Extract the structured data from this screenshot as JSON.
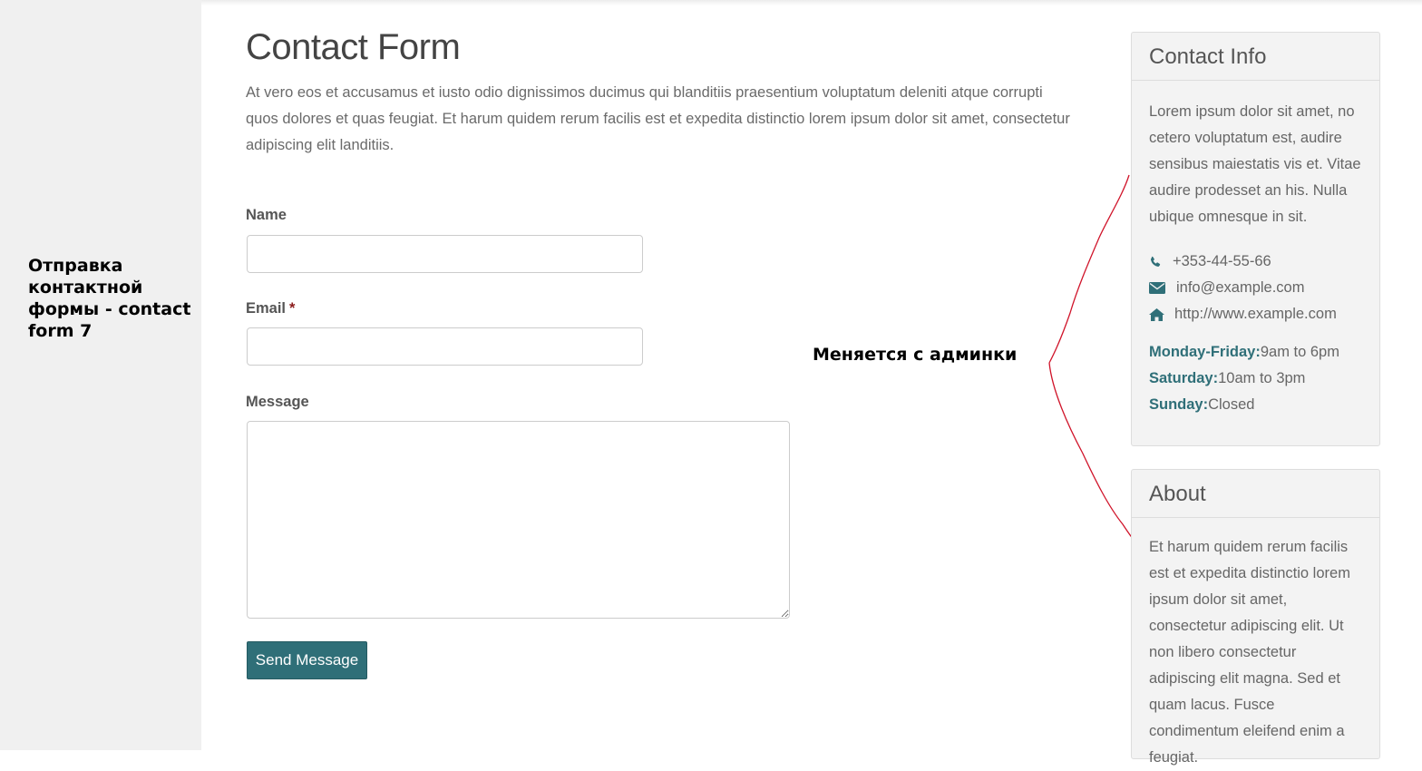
{
  "annotations": {
    "left_note": "Отправка контактной формы - contact form 7",
    "middle_note": "Меняется с админки"
  },
  "main": {
    "title": "Contact Form",
    "intro": "At vero eos et accusamus et iusto odio dignissimos ducimus qui blanditiis praesentium voluptatum deleniti atque corrupti quos dolores et quas feugiat. Et harum quidem rerum facilis est et expedita distinctio lorem ipsum dolor sit amet, consectetur adipiscing elit landitiis."
  },
  "form": {
    "name_label": "Name",
    "name_value": "",
    "email_label": "Email",
    "email_required_mark": "*",
    "email_value": "",
    "message_label": "Message",
    "message_value": "",
    "submit_label": "Send Message"
  },
  "sidebar": {
    "contact_info": {
      "title": "Contact Info",
      "text": "Lorem ipsum dolor sit amet, no cetero voluptatum est, audire sensibus maiestatis vis et. Vitae audire prodesset an his. Nulla ubique omnesque in sit.",
      "contacts": [
        {
          "icon": "phone-icon",
          "value": "+353-44-55-66"
        },
        {
          "icon": "envelope-icon",
          "value": "info@example.com"
        },
        {
          "icon": "home-icon",
          "value": "http://www.example.com"
        }
      ],
      "hours": [
        {
          "day": "Monday-Friday:",
          "time": "9am to 6pm"
        },
        {
          "day": "Saturday:",
          "time": "10am to 3pm"
        },
        {
          "day": "Sunday:",
          "time": "Closed"
        }
      ]
    },
    "about": {
      "title": "About",
      "text": "Et harum quidem rerum facilis est et expedita distinctio lorem ipsum dolor sit amet, consectetur adipiscing elit. Ut non libero consectetur adipiscing elit magna. Sed et quam lacus. Fusce condimentum eleifend enim a feugiat."
    }
  },
  "colors": {
    "accent": "#2f6f78",
    "required": "#8b1a1a",
    "annotation_line": "#d0142a"
  }
}
